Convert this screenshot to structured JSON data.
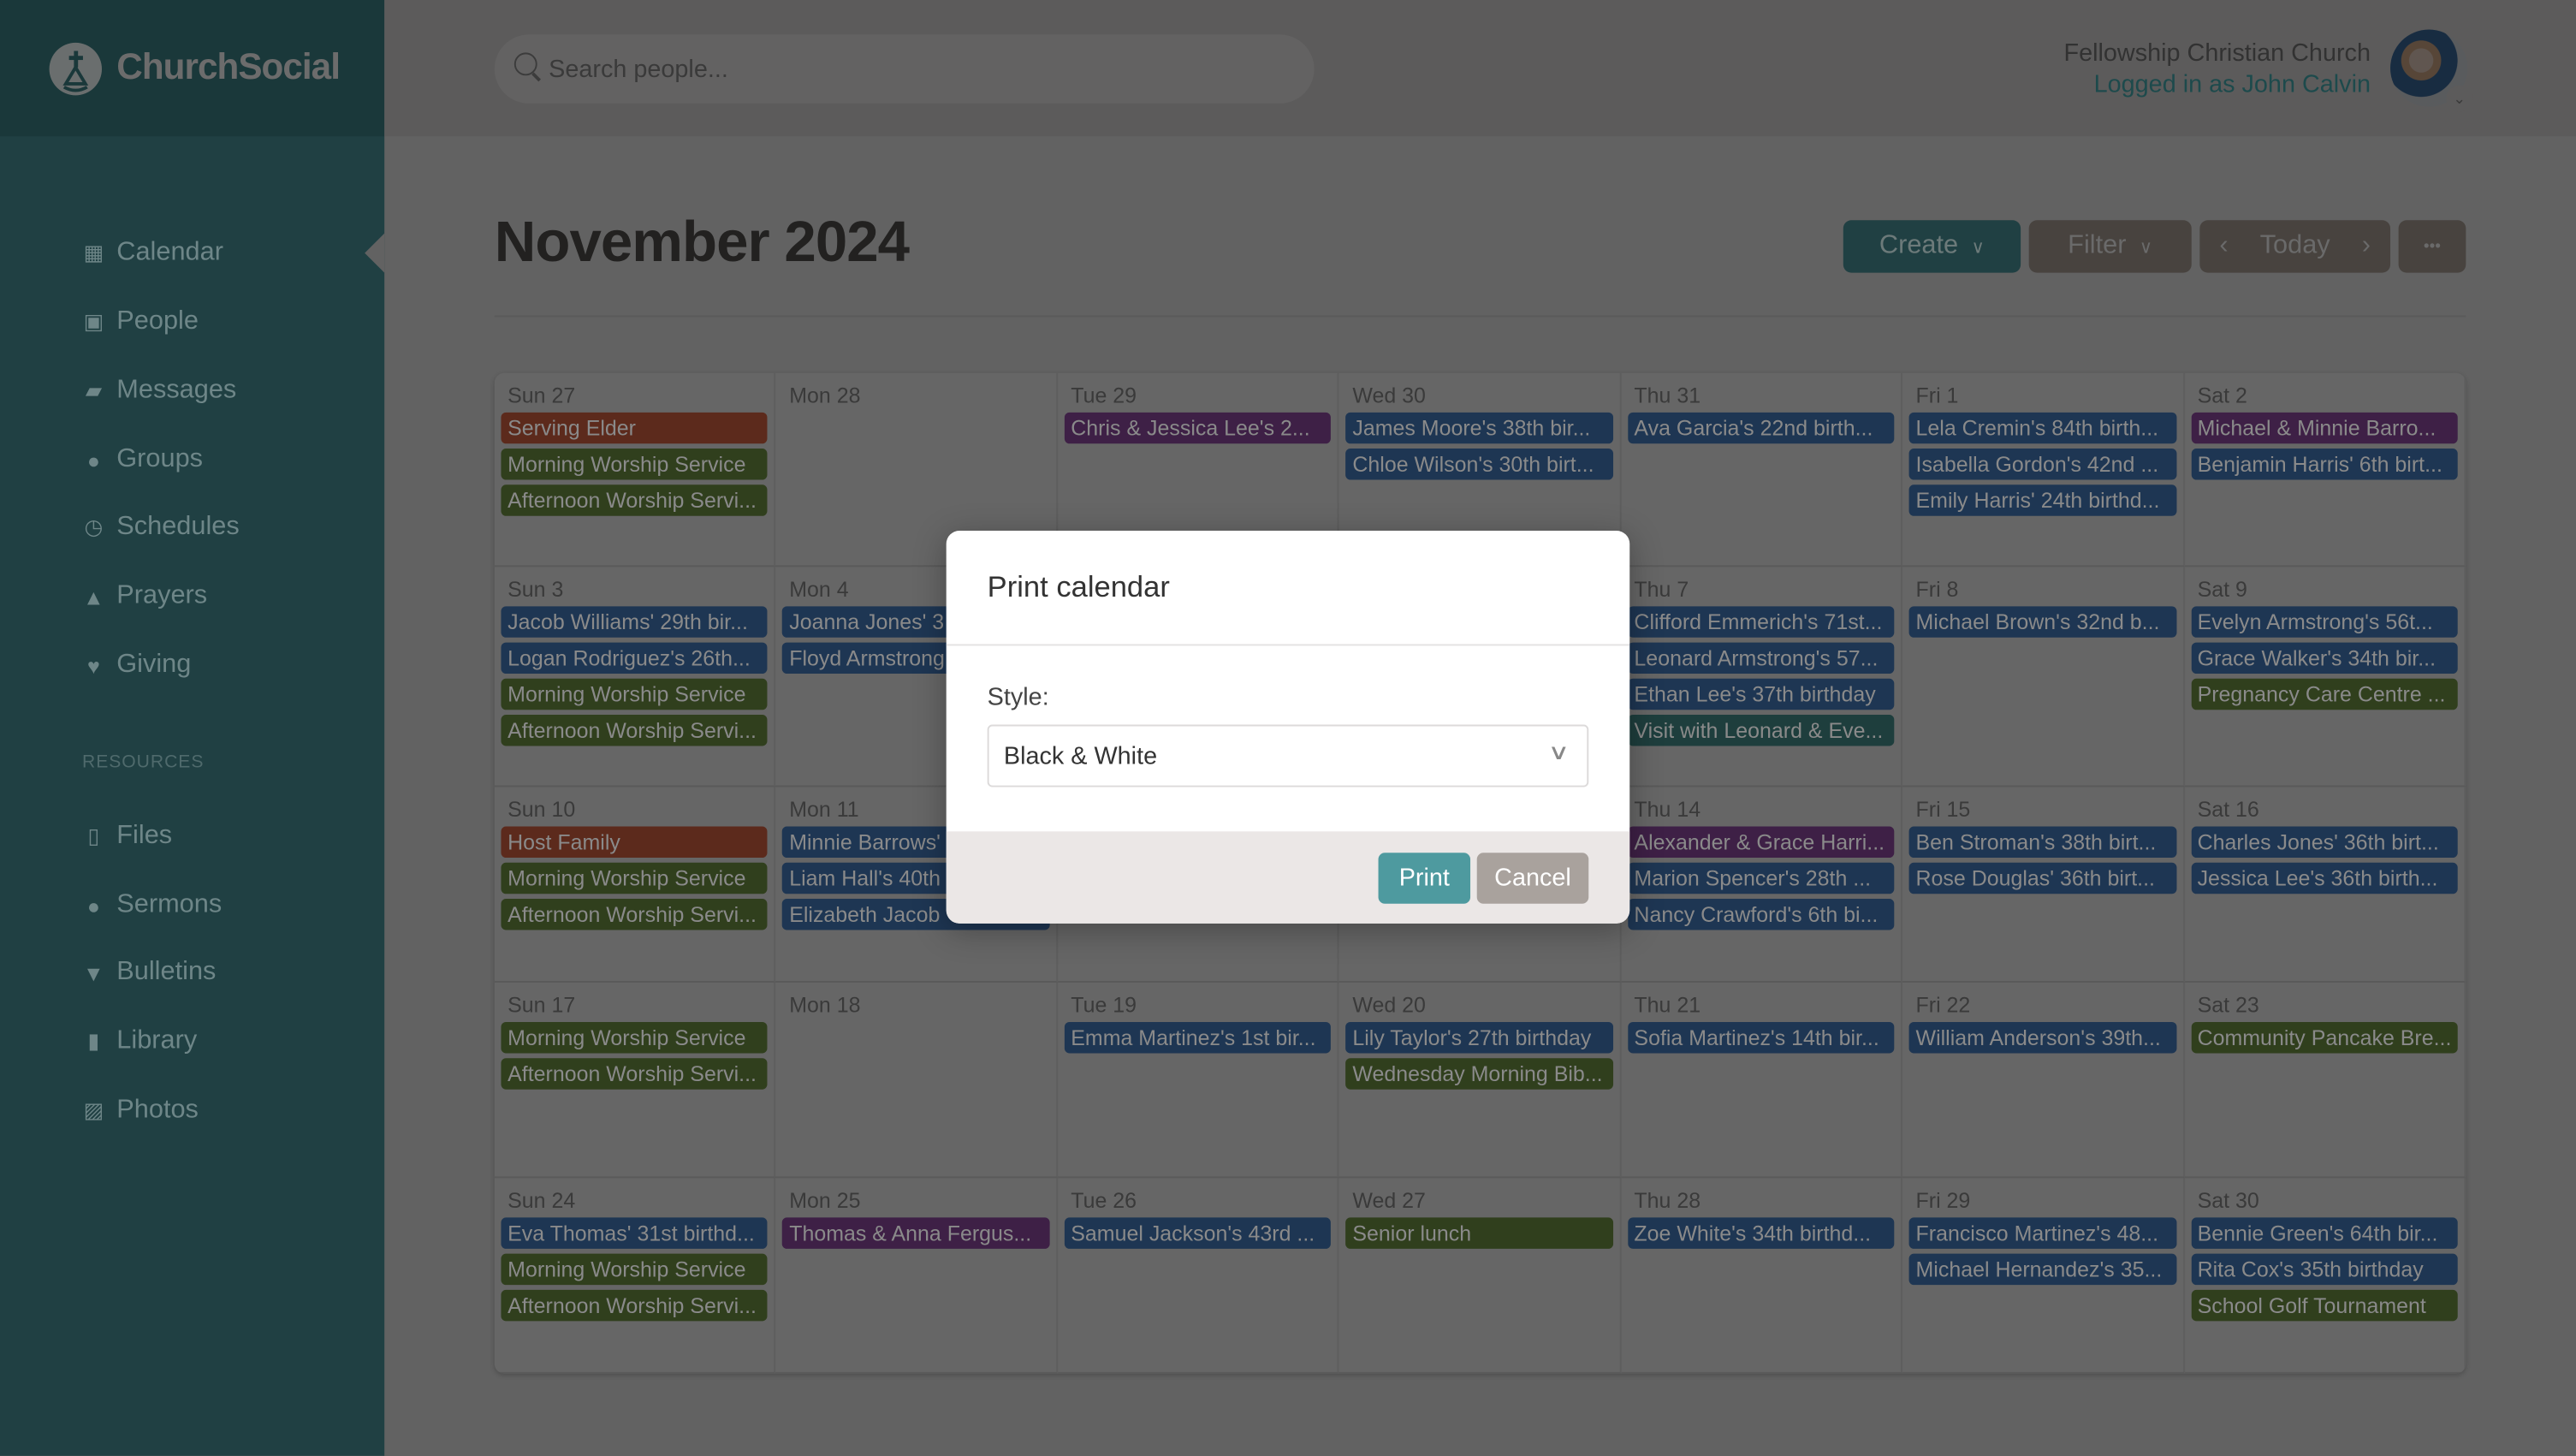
{
  "brand": {
    "name": "ChurchSocial"
  },
  "search": {
    "placeholder": "Search people..."
  },
  "user": {
    "church": "Fellowship Christian Church",
    "logged_in": "Logged in as John Calvin"
  },
  "sidebar": {
    "items": [
      {
        "label": "Calendar",
        "icon": "calendar-icon",
        "glyph": "▦",
        "active": true
      },
      {
        "label": "People",
        "icon": "person-icon",
        "glyph": "▣"
      },
      {
        "label": "Messages",
        "icon": "chat-icon",
        "glyph": "▰"
      },
      {
        "label": "Groups",
        "icon": "groups-icon",
        "glyph": "●"
      },
      {
        "label": "Schedules",
        "icon": "clock-icon",
        "glyph": "◷"
      },
      {
        "label": "Prayers",
        "icon": "praying-hands-icon",
        "glyph": "▲"
      },
      {
        "label": "Giving",
        "icon": "heart-icon",
        "glyph": "♥"
      }
    ],
    "resources_label": "RESOURCES",
    "resources": [
      {
        "label": "Files",
        "icon": "file-icon",
        "glyph": "▯"
      },
      {
        "label": "Sermons",
        "icon": "microphone-icon",
        "glyph": "●"
      },
      {
        "label": "Bulletins",
        "icon": "pin-icon",
        "glyph": "▼"
      },
      {
        "label": "Library",
        "icon": "book-icon",
        "glyph": "▮"
      },
      {
        "label": "Photos",
        "icon": "image-icon",
        "glyph": "▨"
      }
    ]
  },
  "page": {
    "title": "November 2024"
  },
  "toolbar": {
    "create": "Create",
    "filter": "Filter",
    "today": "Today",
    "more": "•••"
  },
  "colors": {
    "b": "#4a86d0",
    "g": "#789d48",
    "p": "#9c4fb0",
    "r": "#e56a45",
    "t": "#4a9b98",
    "accent": "#4e9a9f"
  },
  "calendar": {
    "weeks": [
      [
        {
          "label": "Sun 27",
          "events": [
            [
              "Serving Elder",
              "r"
            ],
            [
              "Morning Worship Service",
              "g"
            ],
            [
              "Afternoon Worship Servi...",
              "g"
            ]
          ]
        },
        {
          "label": "Mon 28",
          "events": []
        },
        {
          "label": "Tue 29",
          "events": [
            [
              "Chris & Jessica Lee's 2...",
              "p"
            ]
          ]
        },
        {
          "label": "Wed 30",
          "events": [
            [
              "James Moore's 38th bir...",
              "b"
            ],
            [
              "Chloe Wilson's 30th birt...",
              "b"
            ]
          ]
        },
        {
          "label": "Thu 31",
          "events": [
            [
              "Ava Garcia's 22nd birth...",
              "b"
            ]
          ]
        },
        {
          "label": "Fri 1",
          "events": [
            [
              "Lela Cremin's 84th birth...",
              "b"
            ],
            [
              "Isabella Gordon's 42nd ...",
              "b"
            ],
            [
              "Emily Harris' 24th birthd...",
              "b"
            ]
          ]
        },
        {
          "label": "Sat 2",
          "events": [
            [
              "Michael & Minnie Barro...",
              "p"
            ],
            [
              "Benjamin Harris' 6th birt...",
              "b"
            ]
          ]
        }
      ],
      [
        {
          "label": "Sun 3",
          "events": [
            [
              "Jacob Williams' 29th bir...",
              "b"
            ],
            [
              "Logan Rodriguez's 26th...",
              "b"
            ],
            [
              "Morning Worship Service",
              "g"
            ],
            [
              "Afternoon Worship Servi...",
              "g"
            ]
          ]
        },
        {
          "label": "Mon 4",
          "events": [
            [
              "Joanna Jones' 3",
              "b"
            ],
            [
              "Floyd Armstrong",
              "b"
            ]
          ]
        },
        {
          "label": "",
          "events": []
        },
        {
          "label": "",
          "events": []
        },
        {
          "label": "Thu 7",
          "events": [
            [
              "Clifford Emmerich's 71st...",
              "b"
            ],
            [
              "Leonard Armstrong's 57...",
              "b"
            ],
            [
              "Ethan Lee's 37th birthday",
              "b"
            ],
            [
              "Visit with Leonard & Eve...",
              "t"
            ]
          ]
        },
        {
          "label": "Fri 8",
          "events": [
            [
              "Michael Brown's 32nd b...",
              "b"
            ]
          ]
        },
        {
          "label": "Sat 9",
          "events": [
            [
              "Evelyn Armstrong's 56t...",
              "b"
            ],
            [
              "Grace Walker's 34th bir...",
              "b"
            ],
            [
              "Pregnancy Care Centre ...",
              "g"
            ]
          ]
        }
      ],
      [
        {
          "label": "Sun 10",
          "events": [
            [
              "Host Family",
              "r"
            ],
            [
              "Morning Worship Service",
              "g"
            ],
            [
              "Afternoon Worship Servi...",
              "g"
            ]
          ]
        },
        {
          "label": "Mon 11",
          "events": [
            [
              "Minnie Barrows'",
              "b"
            ],
            [
              "Liam Hall's 40th",
              "b"
            ],
            [
              "Elizabeth Jacob",
              "b"
            ]
          ]
        },
        {
          "label": "",
          "events": []
        },
        {
          "label": "",
          "events": []
        },
        {
          "label": "Thu 14",
          "events": [
            [
              "Alexander & Grace Harri...",
              "p"
            ],
            [
              "Marion Spencer's 28th ...",
              "b"
            ],
            [
              "Nancy Crawford's 6th bi...",
              "b"
            ]
          ]
        },
        {
          "label": "Fri 15",
          "events": [
            [
              "Ben Stroman's 38th birt...",
              "b"
            ],
            [
              "Rose Douglas' 36th birt...",
              "b"
            ]
          ]
        },
        {
          "label": "Sat 16",
          "events": [
            [
              "Charles Jones' 36th birt...",
              "b"
            ],
            [
              "Jessica Lee's 36th birth...",
              "b"
            ]
          ]
        }
      ],
      [
        {
          "label": "Sun 17",
          "events": [
            [
              "Morning Worship Service",
              "g"
            ],
            [
              "Afternoon Worship Servi...",
              "g"
            ]
          ]
        },
        {
          "label": "Mon 18",
          "events": []
        },
        {
          "label": "Tue 19",
          "events": [
            [
              "Emma Martinez's 1st bir...",
              "b"
            ]
          ]
        },
        {
          "label": "Wed 20",
          "events": [
            [
              "Lily Taylor's 27th birthday",
              "b"
            ],
            [
              "Wednesday Morning Bib...",
              "g"
            ]
          ]
        },
        {
          "label": "Thu 21",
          "events": [
            [
              "Sofia Martinez's 14th bir...",
              "b"
            ]
          ]
        },
        {
          "label": "Fri 22",
          "events": [
            [
              "William Anderson's 39th...",
              "b"
            ]
          ]
        },
        {
          "label": "Sat 23",
          "events": [
            [
              "Community Pancake Bre...",
              "g"
            ]
          ]
        }
      ],
      [
        {
          "label": "Sun 24",
          "events": [
            [
              "Eva Thomas' 31st birthd...",
              "b"
            ],
            [
              "Morning Worship Service",
              "g"
            ],
            [
              "Afternoon Worship Servi...",
              "g"
            ]
          ]
        },
        {
          "label": "Mon 25",
          "events": [
            [
              "Thomas & Anna Fergus...",
              "p"
            ]
          ]
        },
        {
          "label": "Tue 26",
          "events": [
            [
              "Samuel Jackson's 43rd ...",
              "b"
            ]
          ]
        },
        {
          "label": "Wed 27",
          "events": [
            [
              "Senior lunch",
              "g"
            ]
          ]
        },
        {
          "label": "Thu 28",
          "events": [
            [
              "Zoe White's 34th birthd...",
              "b"
            ]
          ]
        },
        {
          "label": "Fri 29",
          "events": [
            [
              "Francisco Martinez's 48...",
              "b"
            ],
            [
              "Michael Hernandez's 35...",
              "b"
            ]
          ]
        },
        {
          "label": "Sat 30",
          "events": [
            [
              "Bennie Green's 64th bir...",
              "b"
            ],
            [
              "Rita Cox's 35th birthday",
              "b"
            ],
            [
              "School Golf Tournament",
              "g"
            ]
          ]
        }
      ]
    ]
  },
  "modal": {
    "title": "Print calendar",
    "style_label": "Style:",
    "style_value": "Black & White",
    "print": "Print",
    "cancel": "Cancel"
  }
}
